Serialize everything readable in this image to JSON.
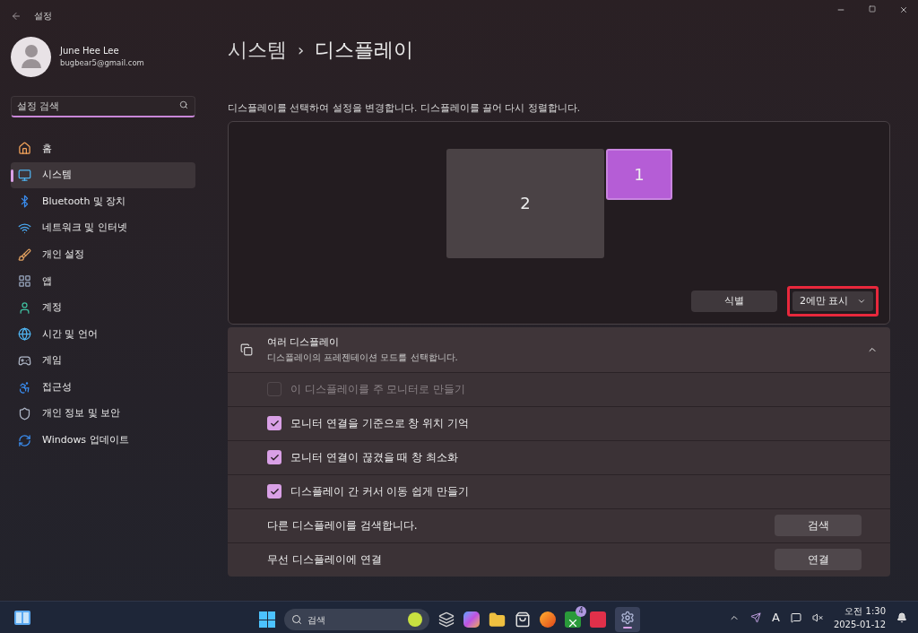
{
  "window": {
    "title": "설정"
  },
  "account": {
    "name": "June Hee Lee",
    "email": "bugbear5@gmail.com"
  },
  "search": {
    "placeholder": "설정 검색"
  },
  "sidebar": {
    "items": [
      {
        "label": "홈",
        "selected": false
      },
      {
        "label": "시스템",
        "selected": true
      },
      {
        "label": "Bluetooth 및 장치",
        "selected": false
      },
      {
        "label": "네트워크 및 인터넷",
        "selected": false
      },
      {
        "label": "개인 설정",
        "selected": false
      },
      {
        "label": "앱",
        "selected": false
      },
      {
        "label": "계정",
        "selected": false
      },
      {
        "label": "시간 및 언어",
        "selected": false
      },
      {
        "label": "게임",
        "selected": false
      },
      {
        "label": "접근성",
        "selected": false
      },
      {
        "label": "개인 정보 및 보안",
        "selected": false
      },
      {
        "label": "Windows 업데이트",
        "selected": false
      }
    ]
  },
  "breadcrumb": {
    "parent": "시스템",
    "separator": "›",
    "current": "디스플레이"
  },
  "arrange": {
    "description": "디스플레이를 선택하여 설정을 변경합니다. 디스플레이를 끌어 다시 정렬합니다.",
    "monitors": [
      {
        "label": "2",
        "selected": false
      },
      {
        "label": "1",
        "selected": true
      }
    ],
    "identify_button": "식별",
    "mode_dropdown": {
      "value": "2에만 표시",
      "highlighted": true
    }
  },
  "multiple_displays": {
    "title": "여러 디스플레이",
    "subtitle": "디스플레이의 프레젠테이션 모드를 선택합니다.",
    "expanded": true,
    "rows": [
      {
        "kind": "checkbox",
        "label": "이 디스플레이를 주 모니터로 만들기",
        "checked": false,
        "disabled": true
      },
      {
        "kind": "checkbox",
        "label": "모니터 연결을 기준으로 창 위치 기억",
        "checked": true,
        "disabled": false
      },
      {
        "kind": "checkbox",
        "label": "모니터 연결이 끊겼을 때 창 최소화",
        "checked": true,
        "disabled": false
      },
      {
        "kind": "checkbox",
        "label": "디스플레이 간 커서 이동 쉽게 만들기",
        "checked": true,
        "disabled": false
      },
      {
        "kind": "button",
        "label": "다른 디스플레이를 검색합니다.",
        "button": "검색"
      },
      {
        "kind": "button",
        "label": "무선 디스플레이에 연결",
        "button": "연결"
      }
    ]
  },
  "taskbar": {
    "search_placeholder": "검색",
    "xbox_badge": "4",
    "input_indicator": "A",
    "time": "오전 1:30",
    "date": "2025-01-12"
  }
}
